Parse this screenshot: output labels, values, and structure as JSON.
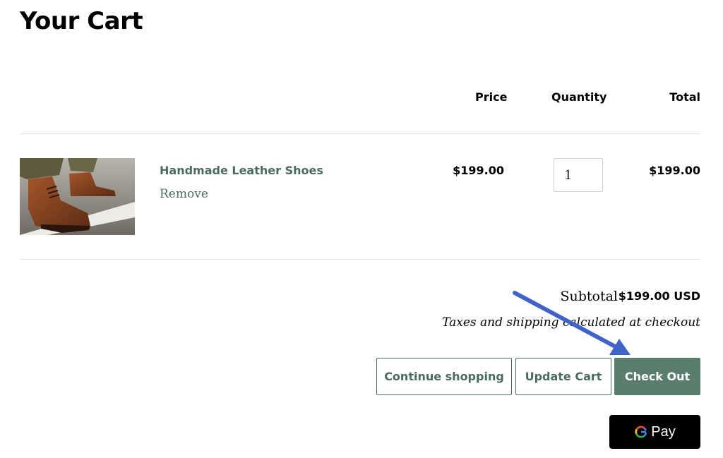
{
  "page": {
    "title": "Your Cart"
  },
  "columns": {
    "price": "Price",
    "quantity": "Quantity",
    "total": "Total"
  },
  "cart": {
    "items": [
      {
        "name": "Handmade Leather Shoes",
        "remove_label": "Remove",
        "price": "$199.00",
        "quantity": "1",
        "total": "$199.00",
        "image_icon": "leather-boots-photo"
      }
    ]
  },
  "summary": {
    "subtotal_label": "Subtotal",
    "subtotal_value": "$199.00 USD",
    "tax_note": "Taxes and shipping calculated at checkout"
  },
  "buttons": {
    "continue_shopping": "Continue shopping",
    "update_cart": "Update Cart",
    "check_out": "Check Out",
    "gpay_label": "Pay"
  },
  "colors": {
    "accent": "#4a6b60",
    "primary_button": "#5a7d6e",
    "annotation_arrow": "#3f63c9"
  }
}
